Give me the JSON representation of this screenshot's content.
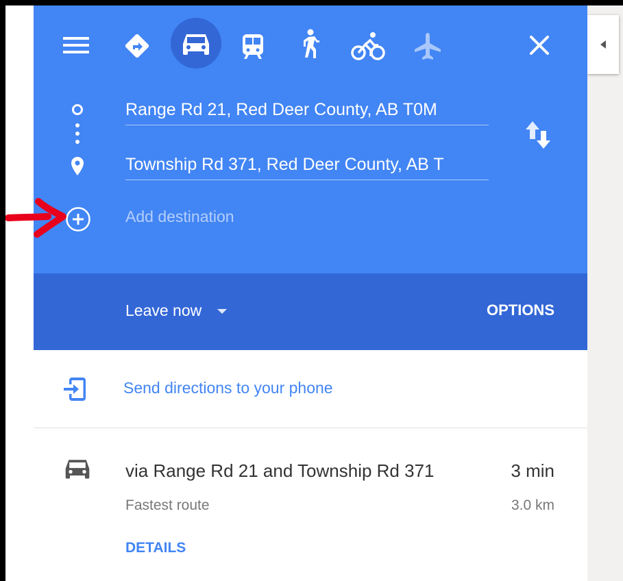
{
  "header": {
    "menu_icon": "hamburger-icon",
    "modes": [
      {
        "name": "best-travel-mode",
        "icon": "directions-diamond-icon"
      },
      {
        "name": "driving",
        "icon": "car-icon",
        "selected": true
      },
      {
        "name": "transit",
        "icon": "train-icon"
      },
      {
        "name": "walking",
        "icon": "walking-icon"
      },
      {
        "name": "cycling",
        "icon": "bicycle-icon"
      },
      {
        "name": "flights",
        "icon": "plane-icon"
      }
    ],
    "close_icon": "close-icon"
  },
  "inputs": {
    "origin": "Range Rd 21, Red Deer County, AB T0M",
    "destination": "Township Rd 371, Red Deer County, AB T",
    "add_placeholder": "Add destination"
  },
  "controls": {
    "leave_label": "Leave now",
    "options_label": "OPTIONS"
  },
  "send": {
    "label": "Send directions to your phone"
  },
  "route": {
    "title": "via Range Rd 21 and Township Rd 371",
    "time": "3 min",
    "subtitle": "Fastest route",
    "distance": "3.0 km",
    "details_label": "DETAILS"
  },
  "colors": {
    "header_blue": "#4285f4",
    "dark_blue": "#3367d6",
    "link_blue": "#4285f4",
    "annotation_red": "#e8001c"
  }
}
